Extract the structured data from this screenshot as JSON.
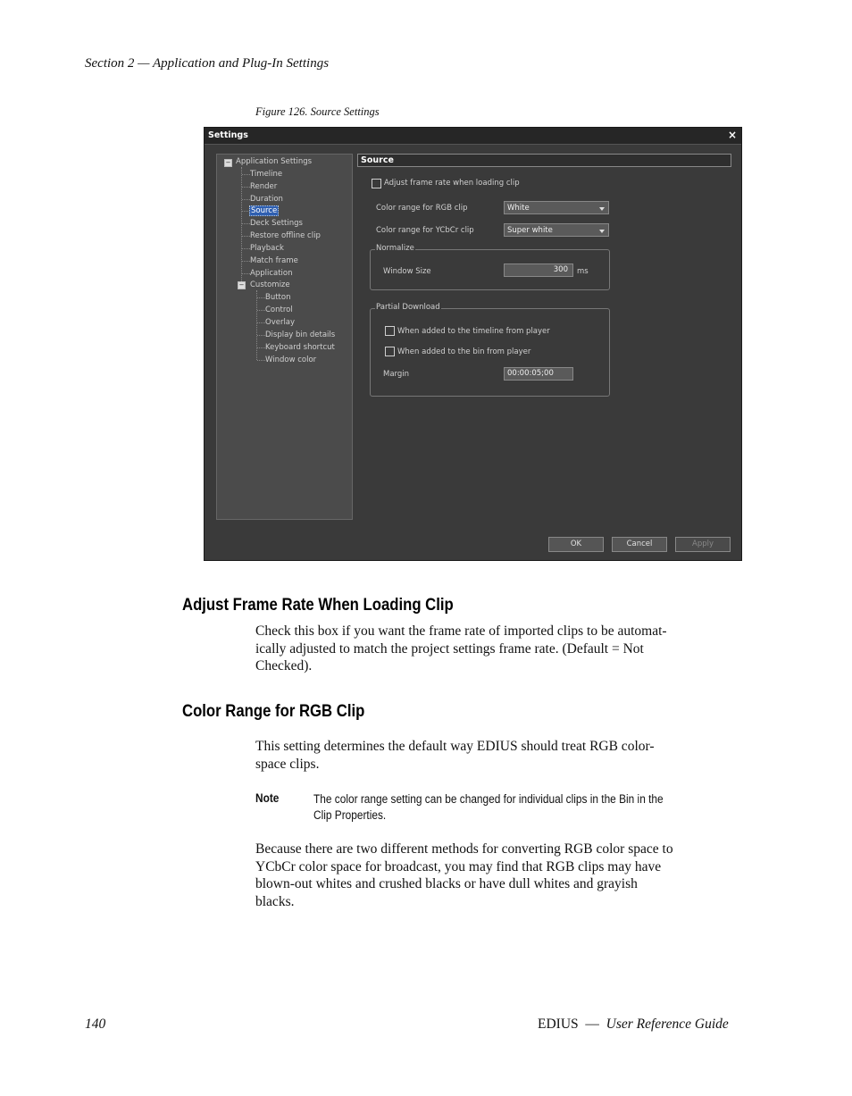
{
  "header": {
    "section": "Section 2 — Application and Plug-In Settings"
  },
  "figure": {
    "caption": "Figure 126.  Source Settings"
  },
  "dialog": {
    "title": "Settings",
    "close": "×",
    "tree": {
      "root": "Application Settings",
      "items": [
        "Timeline",
        "Render",
        "Duration",
        "Source",
        "Deck Settings",
        "Restore offline clip",
        "Playback",
        "Match frame",
        "Application"
      ],
      "customize": "Customize",
      "customize_items": [
        "Button",
        "Control",
        "Overlay",
        "Display bin details",
        "Keyboard shortcut",
        "Window color"
      ]
    },
    "panel_title": "Source",
    "adjust_frame_rate": "Adjust frame rate when loading clip",
    "rgb_label": "Color range for RGB clip",
    "rgb_value": "White",
    "ycbcr_label": "Color range for YCbCr clip",
    "ycbcr_value": "Super white",
    "normalize": {
      "group": "Normalize",
      "label": "Window Size",
      "value": "300",
      "unit": "ms"
    },
    "partial": {
      "group": "Partial Download",
      "timeline_option": "When added to the timeline from player",
      "bin_option": "When added to the bin from player",
      "margin_label": "Margin",
      "margin_value": "00:00:05;00"
    },
    "buttons": {
      "ok": "OK",
      "cancel": "Cancel",
      "apply": "Apply"
    }
  },
  "sections": [
    {
      "heading": "Adjust Frame Rate When Loading Clip",
      "lines": [
        "Check this box if you want the frame rate of imported clips to be automat-",
        "ically adjusted to match the project settings frame rate. (Default = Not",
        "Checked)."
      ]
    },
    {
      "heading": "Color Range for RGB Clip",
      "lines": [
        "This setting determines the default way EDIUS should treat RGB color-",
        "space clips."
      ],
      "note_label": "Note",
      "note_lines": [
        "The color range setting can be changed for individual clips in the Bin in the",
        "Clip Properties."
      ],
      "lines2": [
        "Because there are two different methods for converting RGB color space to",
        "YCbCr color space for broadcast, you may find that RGB clips may have",
        "blown-out whites and crushed blacks or have dull whites and grayish",
        "blacks."
      ]
    }
  ],
  "footer": {
    "page": "140",
    "product": "EDIUS",
    "dash": "—",
    "guide": "User Reference Guide"
  }
}
